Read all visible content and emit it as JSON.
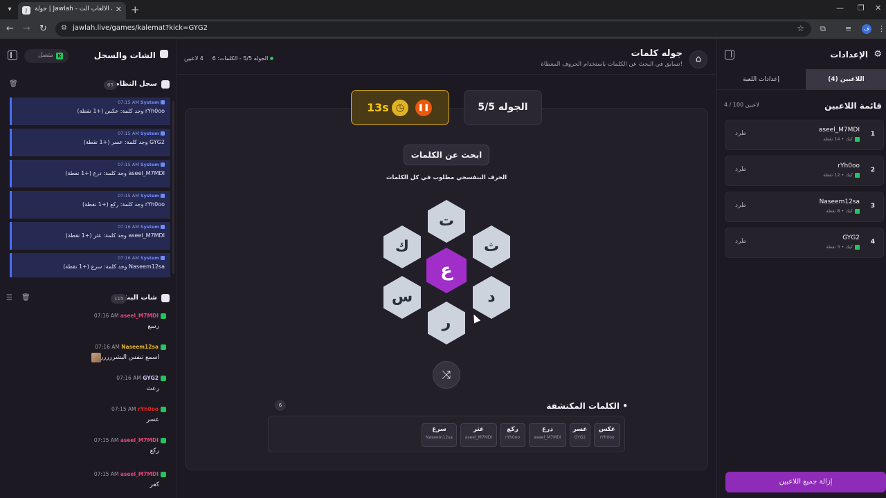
{
  "browser": {
    "tab_title": "جولة | Jawlah - منصة الألعاب الت",
    "favicon_text": "J",
    "url": "jawlah.live/games/kalemat?kick=GYG2",
    "profile_letter": "ف",
    "icons": [
      "dropdown-icon",
      "close-icon",
      "plus-icon",
      "minimize-icon",
      "maximize-icon",
      "window-close-icon",
      "back-icon",
      "forward-icon",
      "reload-icon",
      "site-info-icon",
      "star-icon",
      "extensions-icon",
      "media-icon",
      "menu-icon"
    ]
  },
  "left_panel": {
    "title": "الشات والسجل",
    "status": "متصل",
    "system_log": {
      "title": "سجل النظام",
      "count": "65",
      "entries": [
        {
          "time": "07:15 AM",
          "source": "System",
          "message": "rYh0oo وجد كلمة: عكس (+1 نقطة)"
        },
        {
          "time": "07:15 AM",
          "source": "System",
          "message": "GYG2 وجد كلمة: عسر (+1 نقطة)"
        },
        {
          "time": "07:15 AM",
          "source": "System",
          "message": "aseel_M7MDI وجد كلمة: درع (+1 نقطة)"
        },
        {
          "time": "07:15 AM",
          "source": "System",
          "message": "rYh0oo وجد كلمة: ركع (+1 نقطة)"
        },
        {
          "time": "07:16 AM",
          "source": "System",
          "message": "aseel_M7MDI وجد كلمة: عثر (+1 نقطة)"
        },
        {
          "time": "07:16 AM",
          "source": "System",
          "message": "Naseem12sa وجد كلمة: سرع (+1 نقطة)"
        }
      ]
    },
    "live_chat": {
      "title": "شات البث",
      "count": "115",
      "messages": [
        {
          "time": "07:16 AM",
          "user": "aseel_M7MDI",
          "color": "#e0487a",
          "text": "رسع"
        },
        {
          "time": "07:16 AM",
          "user": "Naseem12sa",
          "color": "#e0b323",
          "text": "اسمع تنفس البشرررررر",
          "avatar": true
        },
        {
          "time": "07:16 AM",
          "user": "GYG2",
          "color": "#c9c6ff",
          "text": "رعث"
        },
        {
          "time": "07:15 AM",
          "user": "rYh0oo",
          "color": "#e02424",
          "text": "عسر"
        },
        {
          "time": "07:15 AM",
          "user": "aseel_M7MDI",
          "color": "#e0487a",
          "text": "ركع"
        },
        {
          "time": "07:15 AM",
          "user": "aseel_M7MDI",
          "color": "#e0487a",
          "text": "كعر"
        }
      ]
    }
  },
  "game": {
    "title": "جوله كلمات",
    "subtitle": "تسابق في البحث عن الكلمات باستخدام الحروف المعطاة!",
    "players_online": "4 لاعبين",
    "round_info": "الجوله 5/5 - الكلمات: 6",
    "round_label": "الجوله 5/5",
    "timer": "13s",
    "instruction_button": "ابحث عن الكلمات",
    "instruction_text": "الحرف البنفسجي مطلوب في كل الكلمات",
    "letters": {
      "center": "ع",
      "top": "ت",
      "top_right": "ث",
      "bottom_right": "د",
      "bottom": "ر",
      "bottom_left": "س",
      "top_left": "ك"
    },
    "found_title": "الكلمات المكتشفة",
    "found_count": "6",
    "found_words": [
      {
        "word": "عكس",
        "by": "rYh0oo"
      },
      {
        "word": "عسر",
        "by": "GYG2"
      },
      {
        "word": "درع",
        "by": "aseel_M7MDI"
      },
      {
        "word": "ركع",
        "by": "rYh0oo"
      },
      {
        "word": "عثر",
        "by": "aseel_M7MDI"
      },
      {
        "word": "سرع",
        "by": "Naseem12sa"
      }
    ],
    "accent": "#a22ec9",
    "timer_color": "#e0b323"
  },
  "right_panel": {
    "title": "الإعدادات",
    "tabs": [
      {
        "label": "اللاعبين (4)",
        "active": true
      },
      {
        "label": "إعدادات اللعبة",
        "active": false
      }
    ],
    "players_title": "قائمة اللاعبين",
    "players_count": "4 / 100 لاعبين",
    "players": [
      {
        "rank": "1",
        "name": "aseel_M7MDI",
        "sub": "كيك • 14 نقطة",
        "kick": "طرد"
      },
      {
        "rank": "2",
        "name": "rYh0oo",
        "sub": "كيك • 12 نقطة",
        "kick": "طرد"
      },
      {
        "rank": "3",
        "name": "Naseem12sa",
        "sub": "كيك • 8 نقطة",
        "kick": "طرد"
      },
      {
        "rank": "4",
        "name": "GYG2",
        "sub": "كيك • 3 نقطة",
        "kick": "طرد"
      }
    ],
    "remove_all": "إزالة جميع اللاعبين"
  }
}
